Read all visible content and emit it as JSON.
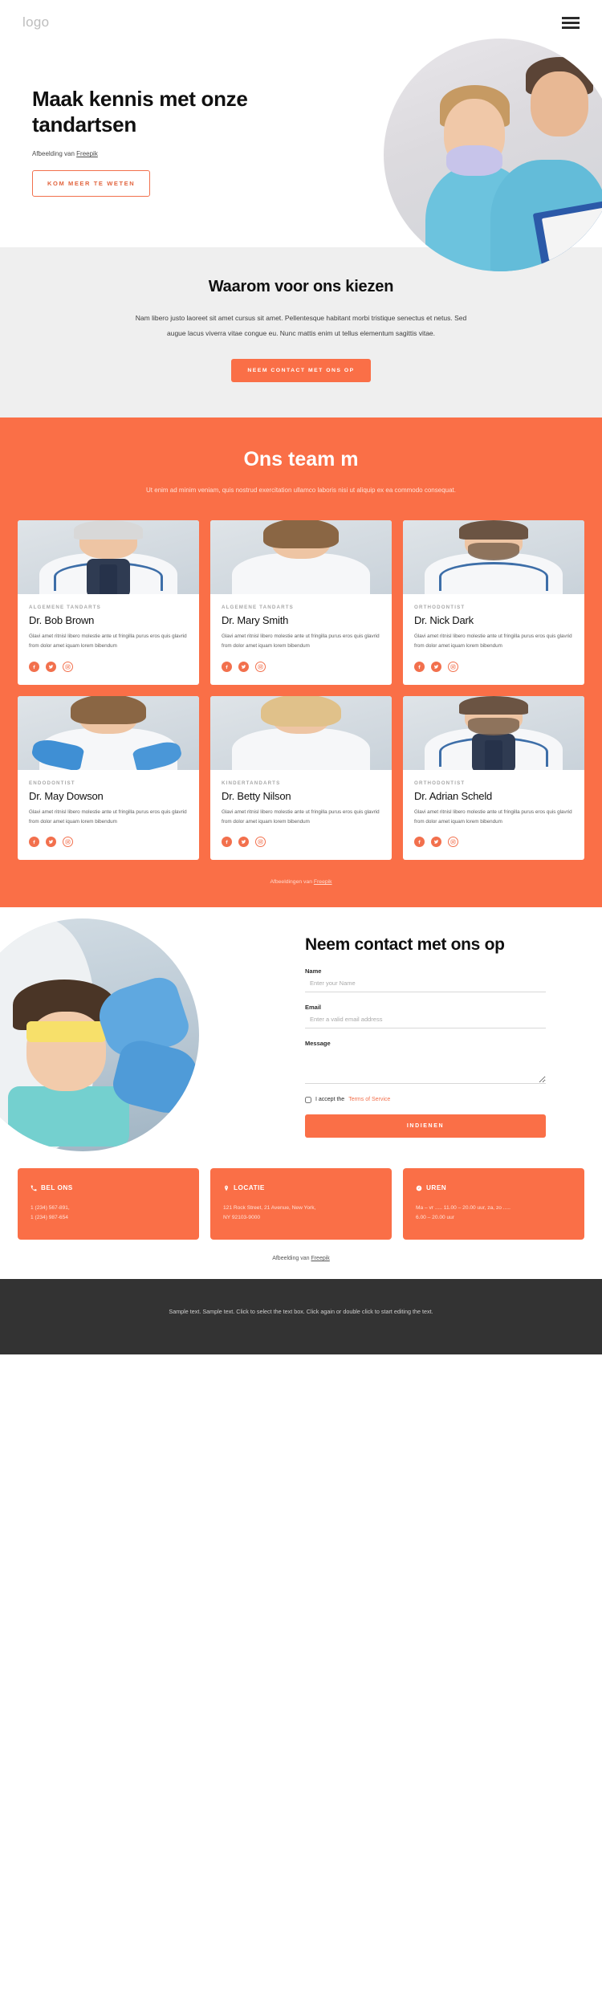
{
  "header": {
    "logo": "logo",
    "menu_icon": "hamburger-menu-icon"
  },
  "hero": {
    "title": "Maak kennis met onze tandartsen",
    "credit_prefix": "Afbeelding van ",
    "credit_link": "Freepik",
    "cta": "KOM MEER TE WETEN"
  },
  "why": {
    "heading": "Waarom voor ons kiezen",
    "paragraph": "Nam libero justo laoreet sit amet cursus sit amet. Pellentesque habitant morbi tristique senectus et netus. Sed augue lacus viverra vitae congue eu. Nunc mattis enim ut tellus elementum sagittis vitae.",
    "cta": "NEEM CONTACT MET ONS OP"
  },
  "team": {
    "heading": "Ons team m",
    "subtitle": "Ut enim ad minim veniam, quis nostrud exercitation ullamco laboris nisi ut aliquip ex ea commodo consequat.",
    "credit_prefix": "Afbeeldingen van ",
    "credit_link": "Freepik",
    "bio": "Glavi amet ritnisl libero molestie ante ut fringilla purus eros quis glavrid from dolor amet iquam lorem bibendum",
    "members": [
      {
        "role": "ALGEMENE TANDARTS",
        "name": "Dr. Bob Brown",
        "bio": "Glavi amet ritnisl libero molestie ante ut fringilla purus eros quis glavrid from dolor amet iquam lorem bibendum"
      },
      {
        "role": "ALGEMENE TANDARTS",
        "name": "Dr. Mary Smith",
        "bio": "Glavi amet ritnisl libero molestie ante ut fringilla purus eros quis glavrid from dolor amet iquam lorem bibendum"
      },
      {
        "role": "ORTHODONTIST",
        "name": "Dr. Nick Dark",
        "bio": "Glavi amet ritnisl libero molestie ante ut fringilla purus eros quis glavrid from dolor amet iquam lorem bibendum"
      },
      {
        "role": "ENDODONTIST",
        "name": "Dr. May Dowson",
        "bio": "Glavi amet ritnisl libero molestie ante ut fringilla purus eros quis glavrid from dolor amet iquam lorem bibendum"
      },
      {
        "role": "KINDERTANDARTS",
        "name": "Dr. Betty Nilson",
        "bio": "Glavi amet ritnisl libero molestie ante ut fringilla purus eros quis glavrid from dolor amet iquam lorem bibendum"
      },
      {
        "role": "ORTHODONTIST",
        "name": "Dr. Adrian Scheld",
        "bio": "Glavi amet ritnisl libero molestie ante ut fringilla purus eros quis glavrid from dolor amet iquam lorem bibendum"
      }
    ],
    "social_icons": [
      "facebook-icon",
      "twitter-icon",
      "instagram-icon"
    ]
  },
  "contact": {
    "heading": "Neem contact met ons op",
    "name_label": "Name",
    "name_placeholder": "Enter your Name",
    "name_value": "",
    "email_label": "Email",
    "email_placeholder": "Enter a valid email address",
    "email_value": "",
    "message_label": "Message",
    "message_placeholder": "",
    "message_value": "",
    "accept_text": "I accept the ",
    "terms_link": "Terms of Service",
    "submit": "INDIENEN"
  },
  "info_cards": [
    {
      "icon": "phone-icon",
      "title": "BEL ONS",
      "lines": "1 (234) 567-891,\n1 (234) 987-654"
    },
    {
      "icon": "location-icon",
      "title": "LOCATIE",
      "lines": "121 Rock Street, 21 Avenue, New York,\nNY 92103-9000"
    },
    {
      "icon": "clock-icon",
      "title": "UREN",
      "lines": "Ma – vr ..... 11.00 – 20.00 uur, za, zo .....\n6.00 – 20.00 uur"
    }
  ],
  "page_credit": {
    "prefix": "Afbeelding van ",
    "link": "Freepik"
  },
  "footer": {
    "text": "Sample text. Sample text. Click to select the text box. Click again or double click to start editing the text."
  },
  "colors": {
    "accent": "#fa6f47",
    "accent_outline": "#f2704d",
    "section_gray": "#efefef",
    "footer_dark": "#333333",
    "heading": "#101010"
  }
}
